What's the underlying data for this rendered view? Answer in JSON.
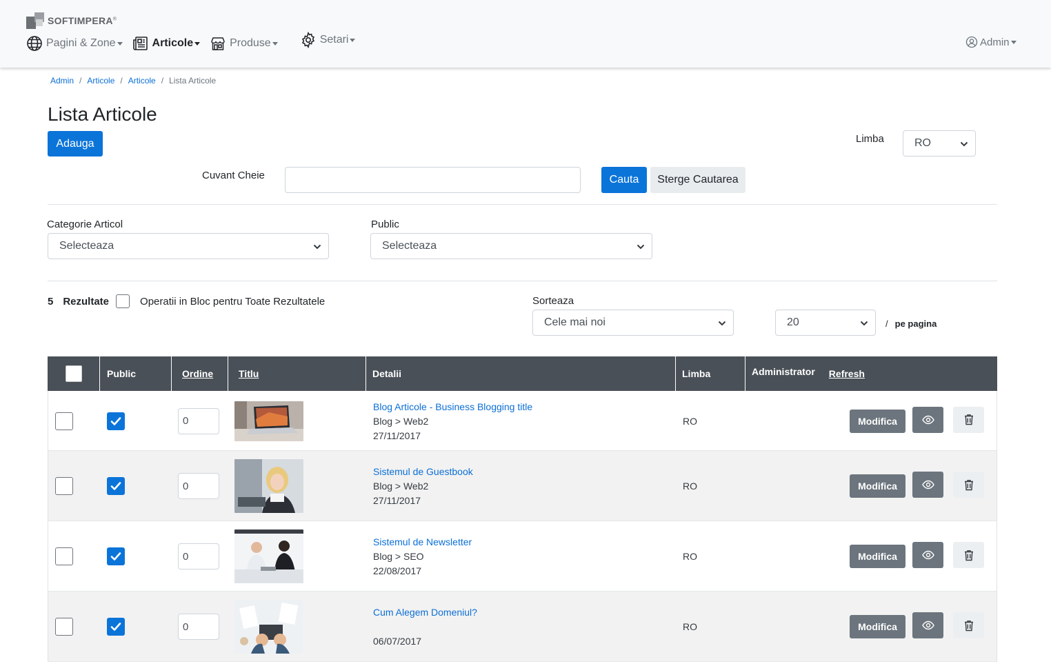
{
  "brand": {
    "name": "SOFTIMPERA",
    "mark": "®"
  },
  "nav": {
    "items": [
      {
        "label": "Pagini & Zone",
        "icon": "globe-icon"
      },
      {
        "label": "Articole",
        "icon": "newspaper-icon",
        "active": true
      },
      {
        "label": "Produse",
        "icon": "store-icon"
      },
      {
        "label": "Setari",
        "icon": "gear-icon"
      }
    ],
    "user": {
      "label": "Admin",
      "icon": "user-circle-icon"
    }
  },
  "breadcrumb": {
    "items": [
      "Admin",
      "Articole",
      "Articole"
    ],
    "current": "Lista Articole"
  },
  "page": {
    "title": "Lista Articole",
    "add_label": "Adauga"
  },
  "language": {
    "label": "Limba",
    "value": "RO"
  },
  "search": {
    "label": "Cuvant Cheie",
    "value": "",
    "placeholder": "",
    "search_label": "Cauta",
    "clear_label": "Sterge Cautarea"
  },
  "filters": {
    "category": {
      "label": "Categorie Articol",
      "value": "Selecteaza"
    },
    "public": {
      "label": "Public",
      "value": "Selecteaza"
    }
  },
  "results": {
    "count": "5",
    "label": "Rezultate",
    "bulk_label": "Operatii in Bloc pentru Toate Rezultatele"
  },
  "sort": {
    "label": "Sorteaza",
    "value": "Cele mai noi"
  },
  "per_page": {
    "value": "20",
    "separator": "/",
    "label": "pe pagina"
  },
  "table": {
    "headers": {
      "public": "Public",
      "order": "Ordine",
      "title": "Titlu",
      "details": "Detalii",
      "language": "Limba",
      "admin": "Administrator",
      "refresh": "Refresh"
    },
    "actions": {
      "edit": "Modifica"
    },
    "rows": [
      {
        "order": "0",
        "title": "Blog Articole - Business Blogging title",
        "category": "Blog > Web2",
        "date": "27/11/2017",
        "language": "RO",
        "public": true,
        "thumb": "laptop"
      },
      {
        "order": "0",
        "title": "Sistemul de Guestbook",
        "category": "Blog > Web2",
        "date": "27/11/2017",
        "language": "RO",
        "public": true,
        "thumb": "woman"
      },
      {
        "order": "0",
        "title": "Sistemul de Newsletter",
        "category": "Blog > SEO",
        "date": "22/08/2017",
        "language": "RO",
        "public": true,
        "thumb": "meeting"
      },
      {
        "order": "0",
        "title": "Cum Alegem Domeniul?",
        "category": "",
        "date": "06/07/2017",
        "language": "RO",
        "public": true,
        "thumb": "desk"
      }
    ]
  }
}
